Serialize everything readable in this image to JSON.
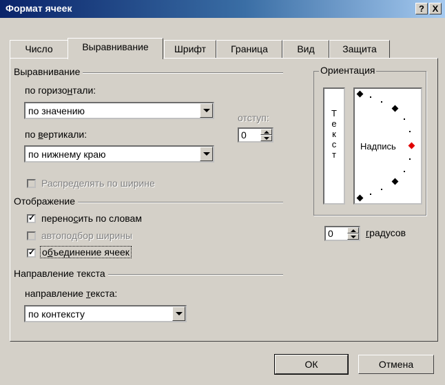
{
  "window": {
    "title": "Формат ячеек",
    "help_label": "?",
    "close_label": "X"
  },
  "tabs": [
    {
      "label": "Число"
    },
    {
      "label": "Выравнивание"
    },
    {
      "label": "Шрифт"
    },
    {
      "label": "Граница"
    },
    {
      "label": "Вид"
    },
    {
      "label": "Защита"
    }
  ],
  "alignment": {
    "group_label": "Выравнивание",
    "horizontal_label_pre": "по горизо",
    "horizontal_label_ul": "н",
    "horizontal_label_post": "тали:",
    "horizontal_value": "по значению",
    "indent_label": "отступ:",
    "indent_value": "0",
    "vertical_label_pre": "по ",
    "vertical_label_ul": "в",
    "vertical_label_post": "ертикали:",
    "vertical_value": "по нижнему краю",
    "distribute_label": "Распределять по ширине"
  },
  "display": {
    "group_label": "Отображение",
    "wrap_pre": "перено",
    "wrap_ul": "с",
    "wrap_post": "ить по словам",
    "wrap_checked": true,
    "autofit_label": "автоподбор ширины",
    "autofit_checked": false,
    "merge_pre": "о",
    "merge_ul": "б",
    "merge_post": "ъединение ячеек",
    "merge_checked": true
  },
  "text_direction": {
    "group_label": "Направление текста",
    "label_pre": "направление ",
    "label_ul": "т",
    "label_post": "екста:",
    "value": "по контексту"
  },
  "orientation": {
    "group_label": "Ориентация",
    "vertical_text": [
      "Т",
      "е",
      "к",
      "с",
      "т"
    ],
    "caption": "Надпись",
    "degrees_value": "0",
    "degrees_ul": "г",
    "degrees_post": "радусов",
    "indicator_color": "#e00000"
  },
  "buttons": {
    "ok": "ОК",
    "cancel": "Отмена"
  }
}
